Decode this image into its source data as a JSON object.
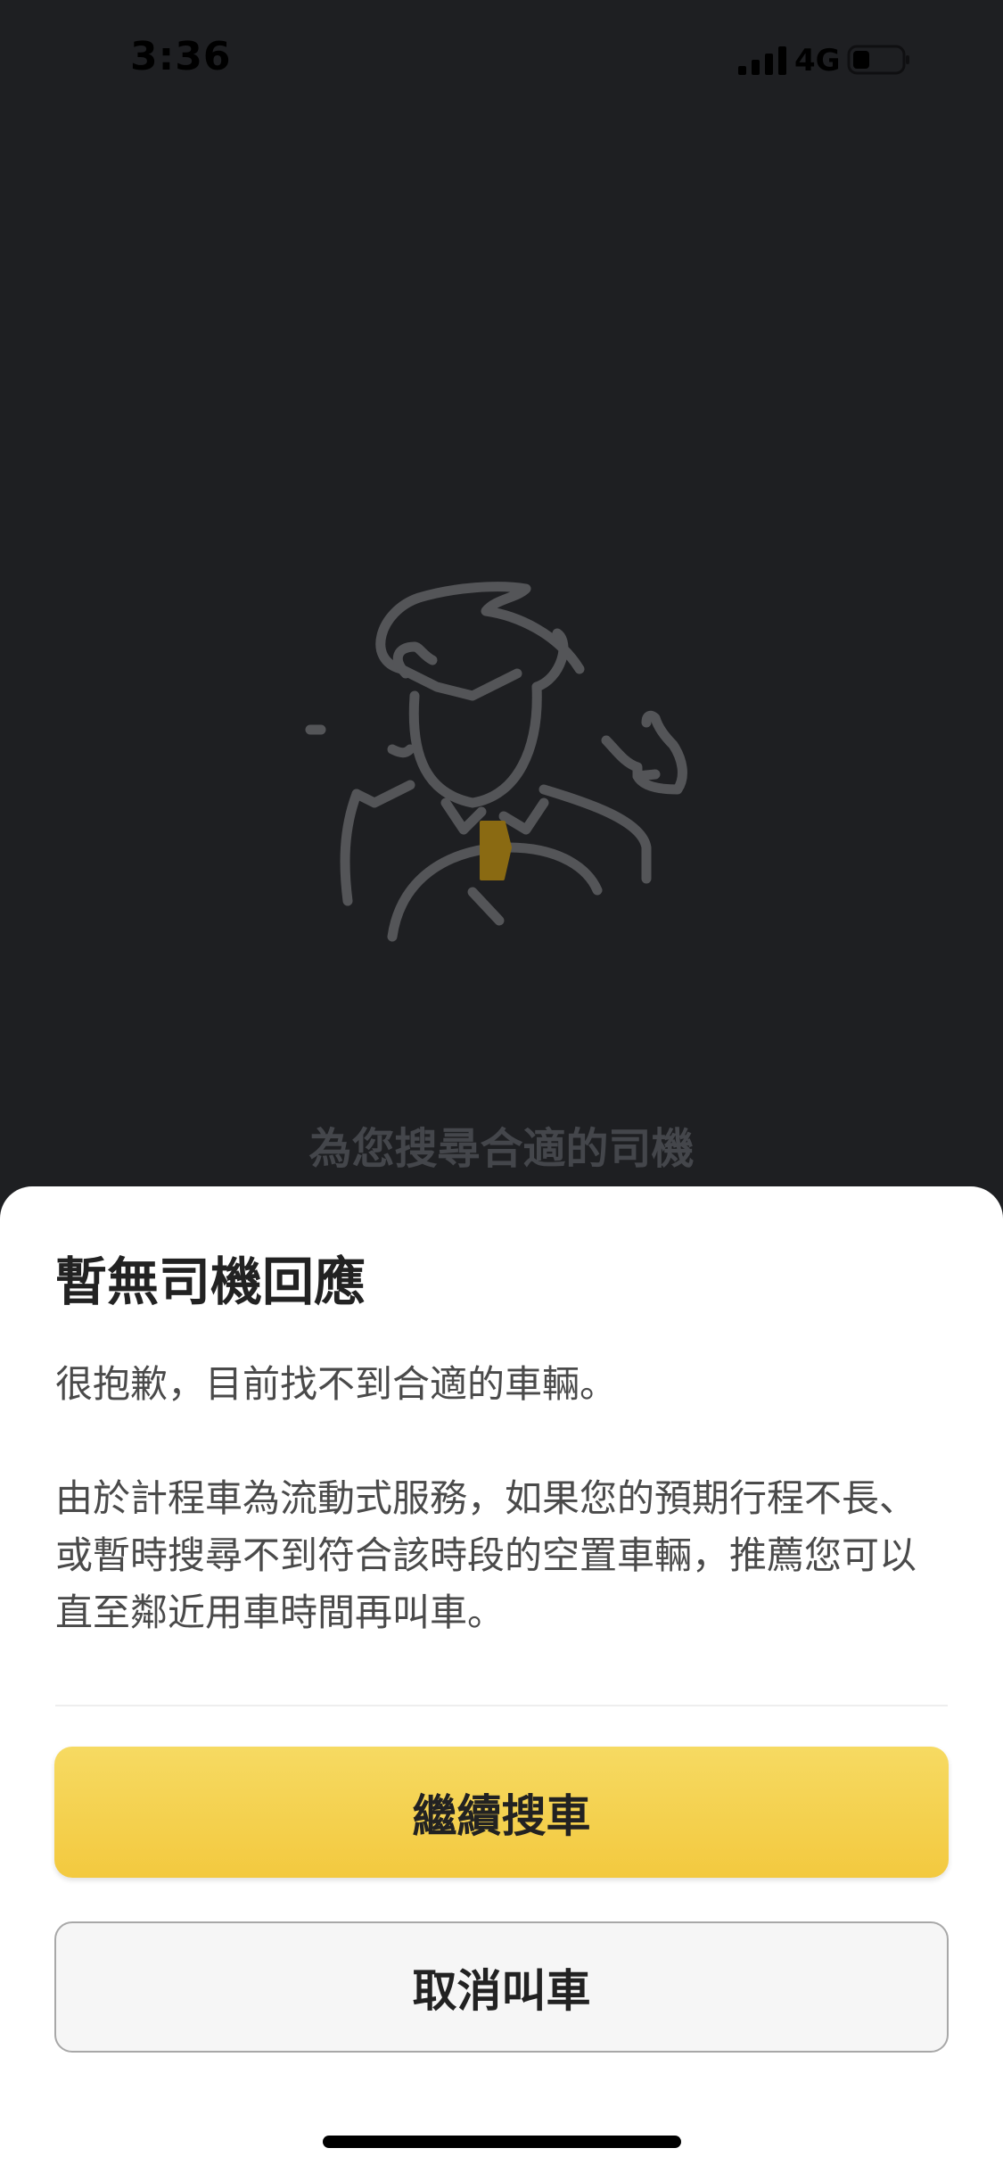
{
  "status_bar": {
    "time": "3:36",
    "network": "4G",
    "icons": [
      "signal-bars-icon",
      "battery-icon"
    ]
  },
  "background": {
    "illustration": "driver-icon",
    "searching_text": "為您搜尋合適的司機"
  },
  "sheet": {
    "title": "暫無司機回應",
    "message_line1": "很抱歉，目前找不到合適的車輛。",
    "message_line2": "由於計程車為流動式服務，如果您的預期行程不長、或暫時搜尋不到符合該時段的空置車輛，推薦您可以直至鄰近用車時間再叫車。",
    "continue_label": "繼續搜車",
    "cancel_label": "取消叫車"
  },
  "colors": {
    "background": "#1e1f22",
    "primary_button": "#f4d04e",
    "tie": "#8a6a12"
  }
}
